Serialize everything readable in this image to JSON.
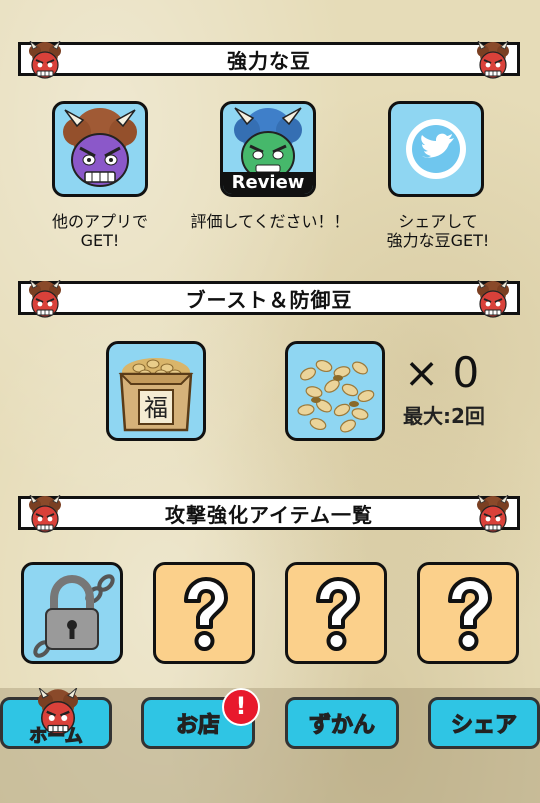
{
  "sections": {
    "strong_beans": {
      "title": "強力な豆"
    },
    "boost_defense": {
      "title": "ブースト＆防御豆"
    },
    "attack_items": {
      "title": "攻撃強化アイテム一覧"
    }
  },
  "strong_beans": {
    "other_apps": {
      "caption_line1": "他のアプリで",
      "caption_line2": "GET!",
      "icon": "purple-oni-icon"
    },
    "review": {
      "caption_line1": "評価してください！！",
      "badge": "Review",
      "icon": "green-oni-icon"
    },
    "share": {
      "caption_line1": "シェアして",
      "caption_line2": "強力な豆GET!",
      "icon": "twitter-bird-icon"
    }
  },
  "boost": {
    "masu_icon": "fuku-masu-icon",
    "masu_kanji": "福",
    "beans_icon": "beans-icon",
    "count": "× 0",
    "max": "最大:2回"
  },
  "attack_items": [
    {
      "state": "locked",
      "icon": "padlock-chain-icon"
    },
    {
      "state": "unknown",
      "icon": "question-mark-icon",
      "glyph": "?"
    },
    {
      "state": "unknown",
      "icon": "question-mark-icon",
      "glyph": "?"
    },
    {
      "state": "unknown",
      "icon": "question-mark-icon",
      "glyph": "?"
    }
  ],
  "nav": {
    "home": "ホーム",
    "shop": "お店",
    "shop_badge": "!",
    "zukan": "ずかん",
    "share": "シェア"
  },
  "colors": {
    "tile_blue": "#8fd6f2",
    "tile_orange": "#fbd08b",
    "nav_blue": "#2fc5e4",
    "badge_red": "#e8192c"
  }
}
